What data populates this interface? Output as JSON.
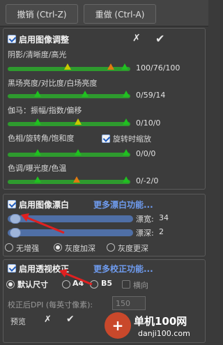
{
  "toolbar": {
    "undo": "撤销 (Ctrl-Z)",
    "redo": "重做 (Ctrl-A)"
  },
  "adjust": {
    "title": "启用图像调整",
    "rows": [
      {
        "label": "阴影/清晰度/高光",
        "value": "100/76/100"
      },
      {
        "label": "黑场亮度/对比度/白场亮度",
        "value": "0/59/14"
      },
      {
        "label": "伽马：振幅/指数/偏移",
        "value": "0/10/0"
      },
      {
        "label": "色相/旋转角/饱和度",
        "value": "0/0/0"
      },
      {
        "label": "色调/曝光度/色温",
        "value": "0/-2/0"
      }
    ],
    "rotate_label": "旋转时缩放"
  },
  "whiten": {
    "title": "启用图像漂白",
    "more": "更多漂白功能...",
    "width_label": "漂宽:",
    "width_value": "34",
    "depth_label": "漂深:",
    "depth_value": "2",
    "options": [
      "无增强",
      "灰度加深",
      "灰度更深"
    ]
  },
  "perspective": {
    "title": "启用透视校正",
    "more": "更多校正功能...",
    "sizes": [
      "默认尺寸",
      "A4",
      "B5"
    ],
    "landscape": "横向",
    "dpi_label": "校正后DPI (每英寸像素):",
    "dpi_placeholder": "150",
    "preview": "预览"
  },
  "watermark": {
    "logo": "+",
    "name": "单机100网",
    "url": "danji100.com"
  },
  "colors": {
    "green": "#2e9a2e",
    "link": "#6f9cf0",
    "arrow": "#e02020"
  }
}
